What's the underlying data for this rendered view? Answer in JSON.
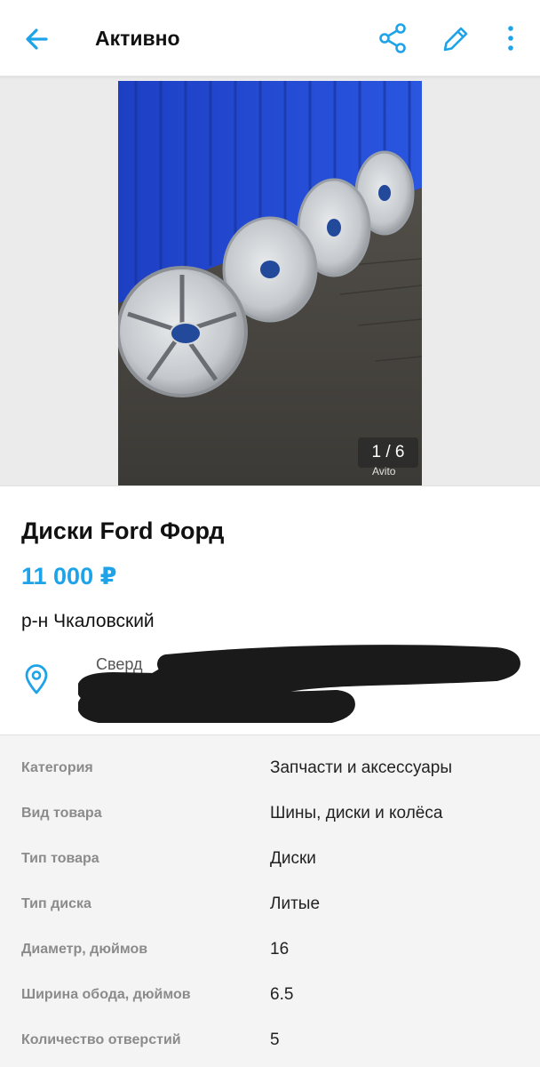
{
  "header": {
    "title": "Активно",
    "colors": {
      "accent": "#1fa3e8"
    },
    "icons": [
      "back-arrow-icon",
      "share-icon",
      "edit-pencil-icon",
      "more-vertical-icon"
    ]
  },
  "gallery": {
    "counter": "1 / 6",
    "watermark": "Avito"
  },
  "listing": {
    "title": "Диски Ford Форд",
    "price": "11 000 ₽",
    "district": "р-н Чкаловский",
    "address_visible": "Сверд",
    "price_color": "#1fa3e8"
  },
  "specs": [
    {
      "label": "Категория",
      "value": "Запчасти и аксессуары"
    },
    {
      "label": "Вид товара",
      "value": "Шины, диски и колёса"
    },
    {
      "label": "Тип товара",
      "value": "Диски"
    },
    {
      "label": "Тип диска",
      "value": "Литые"
    },
    {
      "label": "Диаметр, дюймов",
      "value": "16"
    },
    {
      "label": "Ширина обода, дюймов",
      "value": "6.5"
    },
    {
      "label": "Количество отверстий",
      "value": "5"
    }
  ]
}
